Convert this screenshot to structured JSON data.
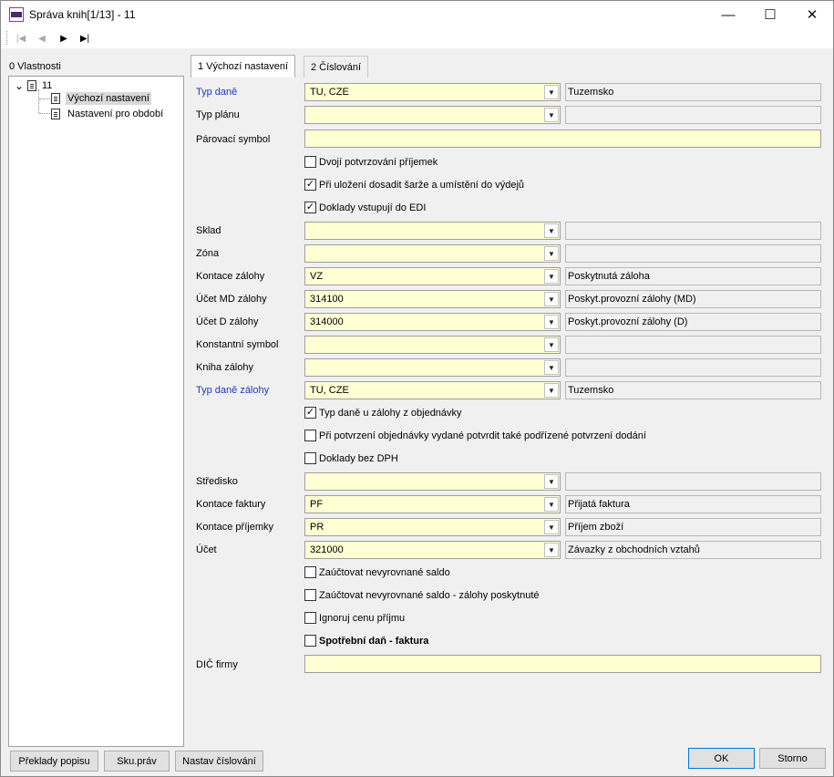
{
  "window": {
    "title": "Správa knih[1/13] - 11",
    "minimize_glyph": "—",
    "maximize_glyph": "☐",
    "close_glyph": "✕"
  },
  "toolbar": {
    "first_glyph": "|◀",
    "prev_glyph": "◀",
    "next_glyph": "▶",
    "last_glyph": "▶|"
  },
  "left": {
    "title": "0 Vlastnosti",
    "tree": {
      "root": "11",
      "expander": "⌄",
      "items": [
        "Výchozí nastavení",
        "Nastavení pro období"
      ]
    }
  },
  "tabs": [
    "1 Výchozí nastavení",
    "2 Číslování"
  ],
  "combo_arrow": "▼",
  "form": {
    "typ_dane": {
      "label": "Typ daně",
      "value": "TU, CZE",
      "desc": "Tuzemsko"
    },
    "typ_planu": {
      "label": "Typ plánu",
      "value": "",
      "desc": ""
    },
    "parovaci": {
      "label": "Párovací symbol",
      "value": ""
    },
    "chk1": {
      "label": "Dvojí potvrzování příjemek",
      "mark": ""
    },
    "chk2": {
      "label": "Při uložení dosadit šarže a umístění do výdejů",
      "mark": "✓"
    },
    "chk3": {
      "label": "Doklady vstupují do EDI",
      "mark": "✓"
    },
    "sklad": {
      "label": "Sklad",
      "value": "",
      "desc": ""
    },
    "zona": {
      "label": "Zóna",
      "value": "",
      "desc": ""
    },
    "kontace_zalohy": {
      "label": "Kontace zálohy",
      "value": "VZ",
      "desc": "Poskytnutá záloha"
    },
    "ucet_md": {
      "label": "Účet MD zálohy",
      "value": "314100",
      "desc": "Poskyt.provozní zálohy (MD)"
    },
    "ucet_d": {
      "label": "Účet D zálohy",
      "value": "314000",
      "desc": "Poskyt.provozní zálohy (D)"
    },
    "konst": {
      "label": "Konstantní symbol",
      "value": "",
      "desc": ""
    },
    "kniha_zalohy": {
      "label": "Kniha zálohy",
      "value": "",
      "desc": ""
    },
    "typ_dane_zalohy": {
      "label": "Typ daně zálohy",
      "value": "TU, CZE",
      "desc": "Tuzemsko"
    },
    "chk4": {
      "label": "Typ daně u zálohy z objednávky",
      "mark": "✓"
    },
    "chk5": {
      "label": "Při potvrzení objednávky vydané potvrdit také podřízené potvrzení dodání",
      "mark": ""
    },
    "chk6": {
      "label": "Doklady bez DPH",
      "mark": ""
    },
    "stredisko": {
      "label": "Středisko",
      "value": "",
      "desc": ""
    },
    "kontace_faktury": {
      "label": "Kontace faktury",
      "value": "PF",
      "desc": "Přijatá faktura"
    },
    "kontace_prijemky": {
      "label": "Kontace příjemky",
      "value": "PR",
      "desc": "Příjem zboží"
    },
    "ucet": {
      "label": "Účet",
      "value": "321000",
      "desc": "Závazky z obchodních vztahů"
    },
    "chk7": {
      "label": "Zaúčtovat nevyrovnané saldo",
      "mark": ""
    },
    "chk8": {
      "label": "Zaúčtovat nevyrovnané saldo - zálohy poskytnuté",
      "mark": ""
    },
    "chk9": {
      "label": "Ignoruj cenu příjmu",
      "mark": ""
    },
    "chk10": {
      "label": "Spotřební daň - faktura",
      "mark": ""
    },
    "dic": {
      "label": "DIČ firmy",
      "value": ""
    }
  },
  "buttons": {
    "preklady": "Překlady popisu",
    "sku": "Sku.práv",
    "nastav": "Nastav číslování",
    "ok": "OK",
    "storno": "Storno"
  },
  "colors": {
    "required_label": "#1b38c8",
    "input_bg": "#ffffd4",
    "default_button_border": "#0078d7"
  }
}
